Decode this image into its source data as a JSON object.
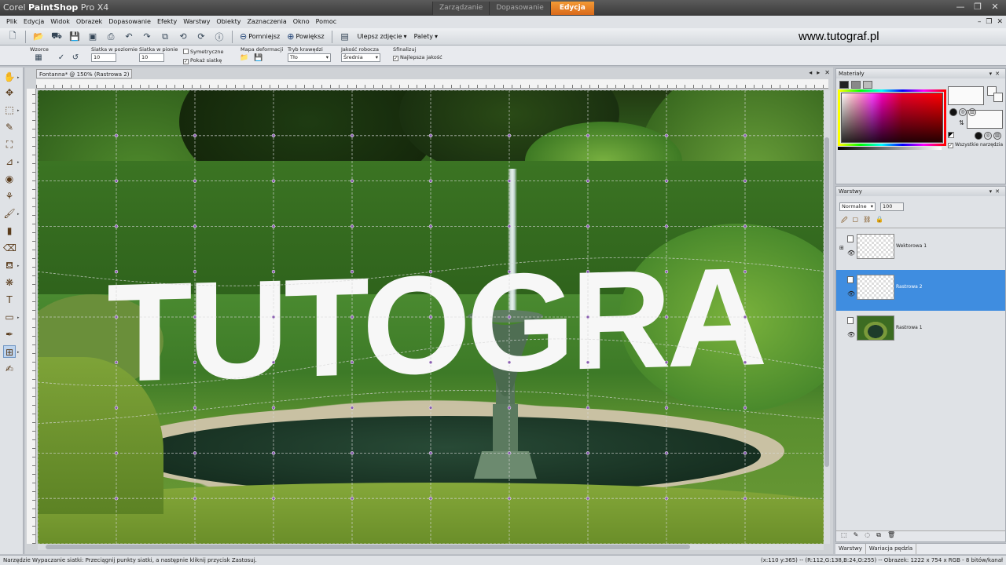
{
  "app": {
    "title_prefix": "Corel",
    "title_name": "PaintShop",
    "title_suffix": "Pro X4",
    "modes": [
      "Zarządzanie",
      "Dopasowanie",
      "Edycja"
    ],
    "active_mode": "Edycja"
  },
  "window_controls": {
    "minimize": "—",
    "restore": "❐",
    "close": "✕"
  },
  "menu": [
    "Plik",
    "Edycja",
    "Widok",
    "Obrazek",
    "Dopasowanie",
    "Efekty",
    "Warstwy",
    "Obiekty",
    "Zaznaczenia",
    "Okno",
    "Pomoc"
  ],
  "toolbar": {
    "zoom_out": "Pomniejsz",
    "zoom_in": "Powiększ",
    "enhance": "Ulepsz zdjęcie",
    "palettes": "Palety"
  },
  "watermark": "www.tutograf.pl",
  "options": {
    "presets_label": "Wzorce",
    "grid_h_label": "Siatka w poziomie",
    "grid_h_value": "10",
    "grid_v_label": "Siatka w pionie",
    "grid_v_value": "10",
    "symmetric": "Symetryczne",
    "show_grid": "Pokaż siatkę",
    "deform_map": "Mapa deformacji",
    "edge_mode_label": "Tryb krawędzi",
    "edge_mode_value": "Tło",
    "draft_quality_label": "Jakość robocza",
    "draft_quality_value": "Średnia",
    "finalize_label": "Sfinalizuj",
    "best_quality": "Najlepsza jakość"
  },
  "document": {
    "tab_title": "Fontanna* @ 150% (Rastrowa 2)",
    "canvas_text": "TUTOGRA"
  },
  "materials": {
    "title": "Materiały",
    "all_tools": "Wszystkie narzędzia"
  },
  "layers": {
    "title": "Warstwy",
    "blend_mode": "Normalne",
    "opacity": "100",
    "items": [
      {
        "name": "Wektorowa 1",
        "selected": false,
        "thumb": "transparent"
      },
      {
        "name": "Rastrowa 2",
        "selected": true,
        "thumb": "transparent"
      },
      {
        "name": "Rastrowa 1",
        "selected": false,
        "thumb": "photo"
      }
    ]
  },
  "bottom_tabs": [
    "Warstwy",
    "Wariacja pędzla"
  ],
  "status": {
    "left": "Narzędzie Wypaczanie siatki: Przeciągnij punkty siatki, a następnie kliknij przycisk Zastosuj.",
    "right": "(x:110 y:365) -- (R:112,G:138,B:24,O:255) -- Obrazek: 1222 x 754 x RGB - 8 bitów/kanał"
  },
  "colors": {
    "active_mode": "#e8791f",
    "selection": "#3f8de0",
    "title_bg": "#464646"
  }
}
